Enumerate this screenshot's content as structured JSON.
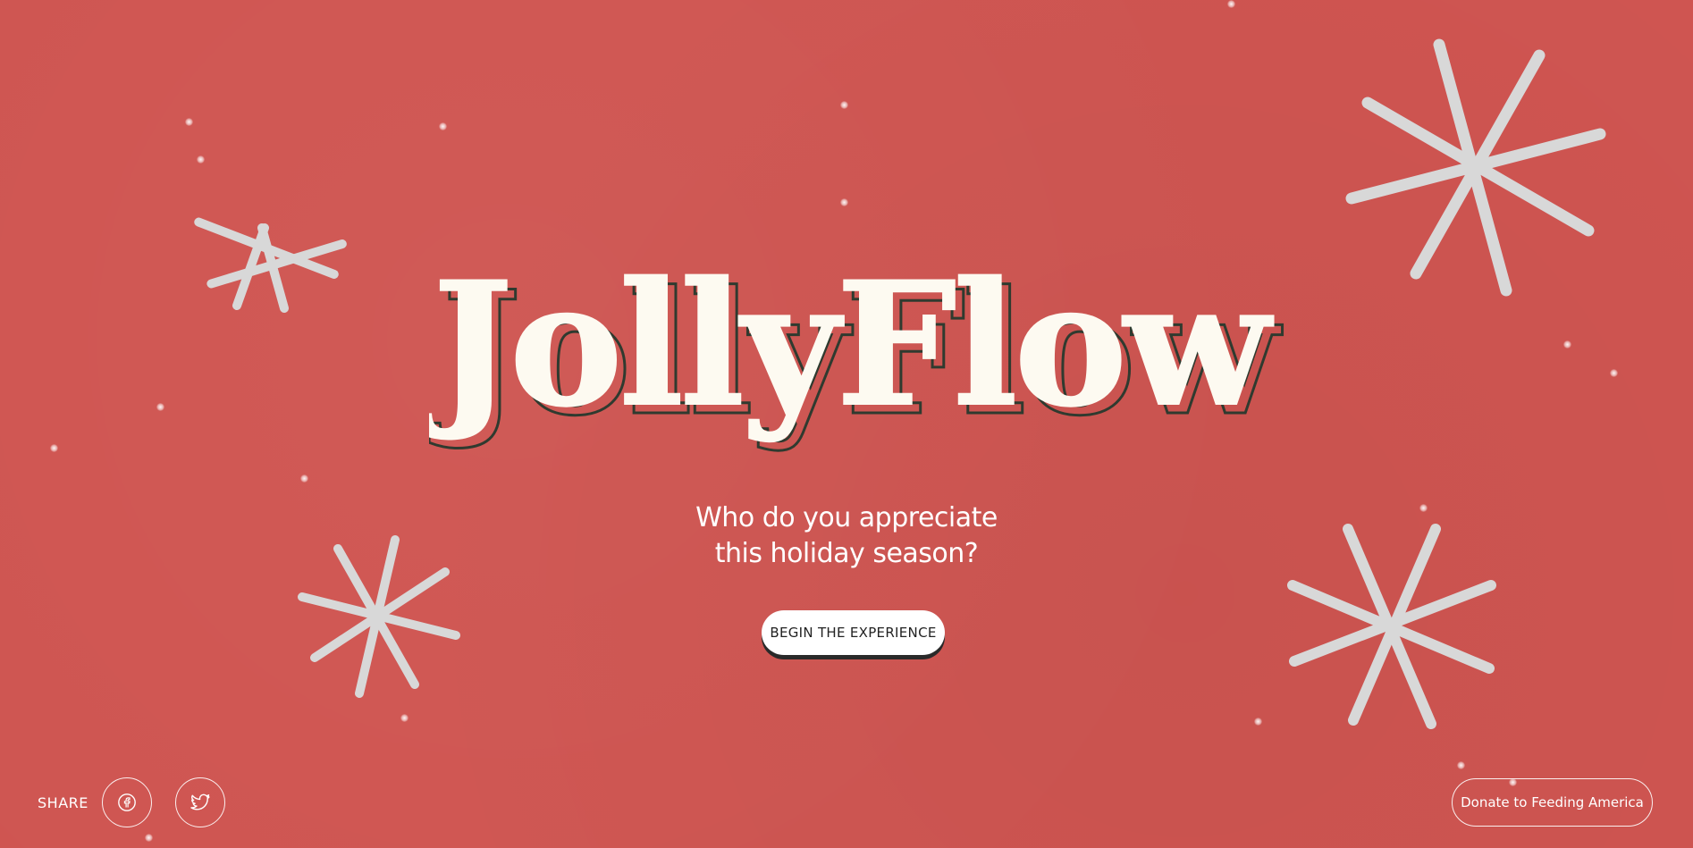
{
  "brand": {
    "title": "JollyFlow",
    "colors": {
      "background": "#cf5551",
      "title_fill": "#fdfaf1",
      "title_outline": "#2f3a2f",
      "button_bg": "#ffffff"
    }
  },
  "hero": {
    "tagline_line1": "Who do you appreciate",
    "tagline_line2": "this holiday season?",
    "cta_label": "BEGIN THE EXPERIENCE"
  },
  "footer": {
    "share_label": "SHARE",
    "facebook_icon": "facebook-icon",
    "twitter_icon": "twitter-icon",
    "donate_label": "Donate to Feeding America"
  }
}
